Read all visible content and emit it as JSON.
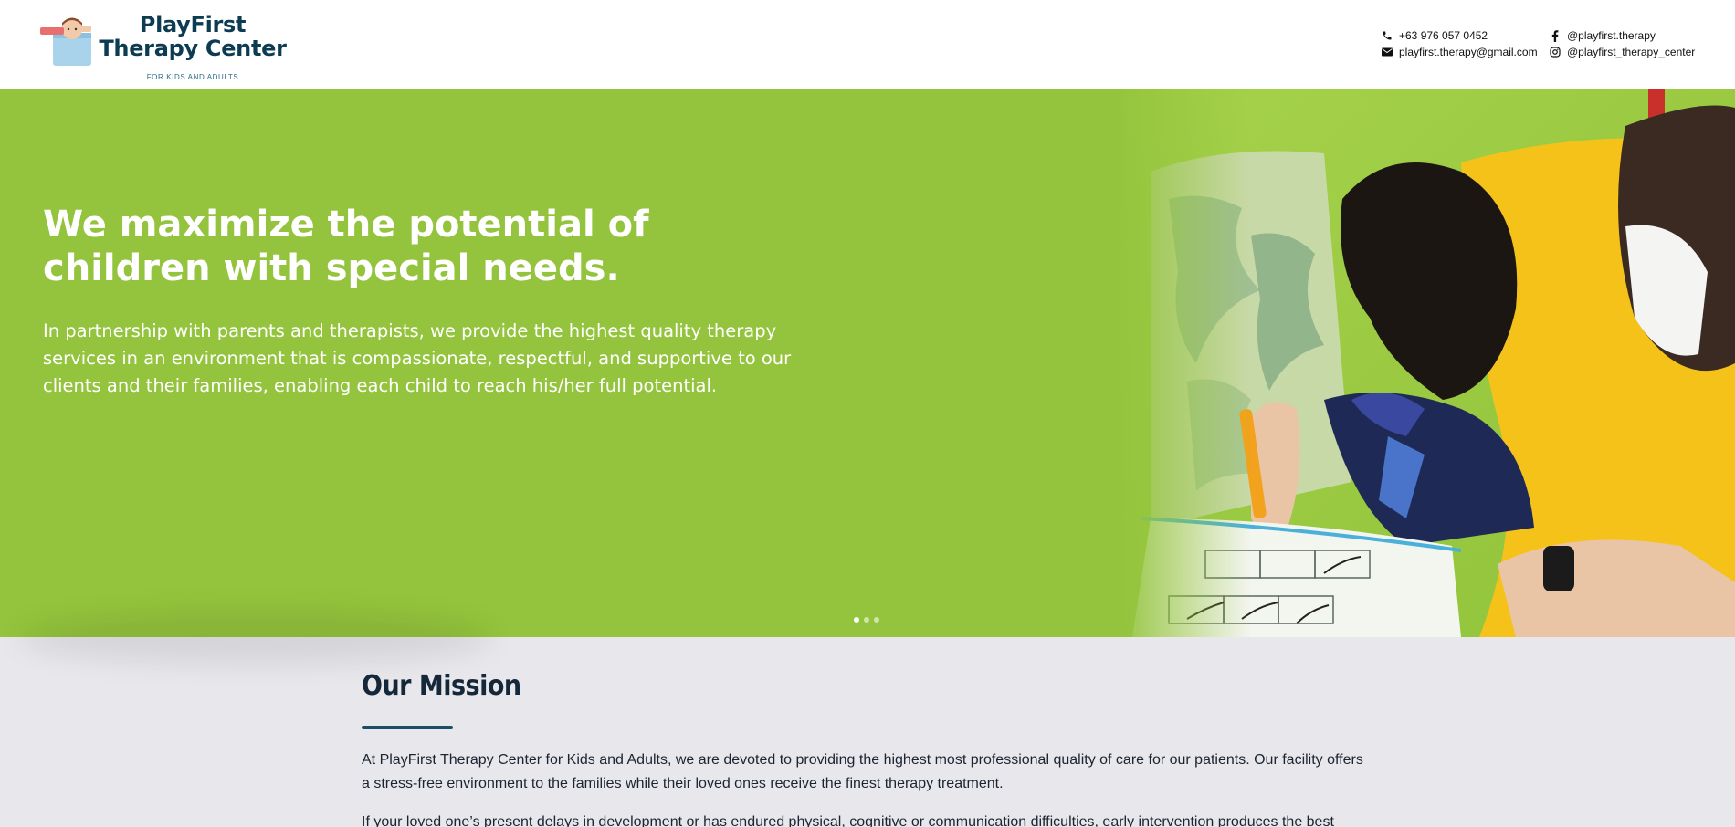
{
  "brand": {
    "name_line1": "PlayFirst",
    "name_line2": "Therapy Center",
    "tagline": "FOR KIDS AND ADULTS"
  },
  "contacts": {
    "phone": "+63 976 057 0452",
    "email": "playfirst.therapy@gmail.com",
    "facebook": "@playfirst.therapy",
    "instagram": "@playfirst_therapy_center",
    "icons": [
      "phone-icon",
      "envelope-icon",
      "facebook-icon",
      "instagram-icon"
    ]
  },
  "hero": {
    "title": "We maximize the potential of children with special needs.",
    "text": "In partnership with parents and therapists, we provide the highest quality therapy services in an environment that is compassionate, respectful, and supportive to our clients and their families, enabling each child to reach his/her full potential.",
    "slides_count": 3,
    "active_slide": 1,
    "background_color": "#94c43d"
  },
  "mission": {
    "title": "Our Mission",
    "paragraph1": "At PlayFirst Therapy Center for Kids and Adults, we are devoted to providing the highest most professional quality of care for our patients. Our facility offers a stress-free environment to the families while their loved ones receive the finest therapy treatment.",
    "paragraph2": "If your loved one’s present delays in development or has endured physical, cognitive or communication difficulties, early intervention produces the best"
  },
  "colors": {
    "brand_navy": "#0d3b52",
    "accent_rule": "#1c4e68",
    "hero_green": "#94c43d",
    "section_bg": "#e8e8ec"
  }
}
